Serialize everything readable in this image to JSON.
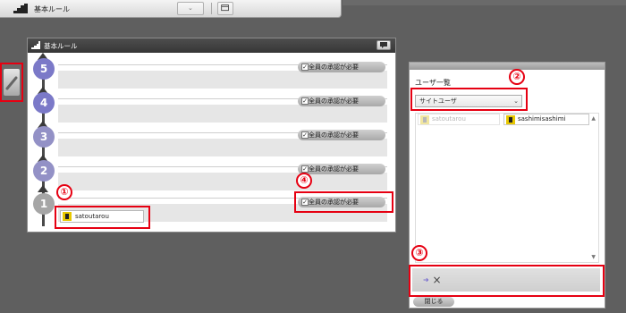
{
  "toolbar": {
    "title": "基本ルール",
    "dropdown_arrow": "⌄",
    "button_icon": "window-icon"
  },
  "left_tool": {
    "icon": "pencil-icon"
  },
  "main_panel": {
    "title": "基本ルール",
    "header_button_icon": "comment-icon",
    "steps": [
      {
        "number": "5",
        "approval_label": "全員の承認が必要",
        "checked": true,
        "color": "#7b79c8"
      },
      {
        "number": "4",
        "approval_label": "全員の承認が必要",
        "checked": true,
        "color": "#7b79c8"
      },
      {
        "number": "3",
        "approval_label": "全員の承認が必要",
        "checked": true,
        "color": "#9391c6"
      },
      {
        "number": "2",
        "approval_label": "全員の承認が必要",
        "checked": true,
        "color": "#9391c6"
      },
      {
        "number": "1",
        "approval_label": "全員の承認が必要",
        "checked": true,
        "color": "#a6a6a6"
      }
    ],
    "assigned_user": "satoutarou"
  },
  "user_panel": {
    "title": "ユーザ一覧",
    "group_select": "サイトユーザ",
    "users": [
      {
        "name": "satoutarou",
        "disabled": true
      },
      {
        "name": "sashimisashimi",
        "disabled": false
      }
    ],
    "action_symbol": "×",
    "close_button": "閉じる"
  },
  "annotations": [
    "①",
    "②",
    "③",
    "④"
  ],
  "colors": {
    "highlight": "#e60012"
  }
}
